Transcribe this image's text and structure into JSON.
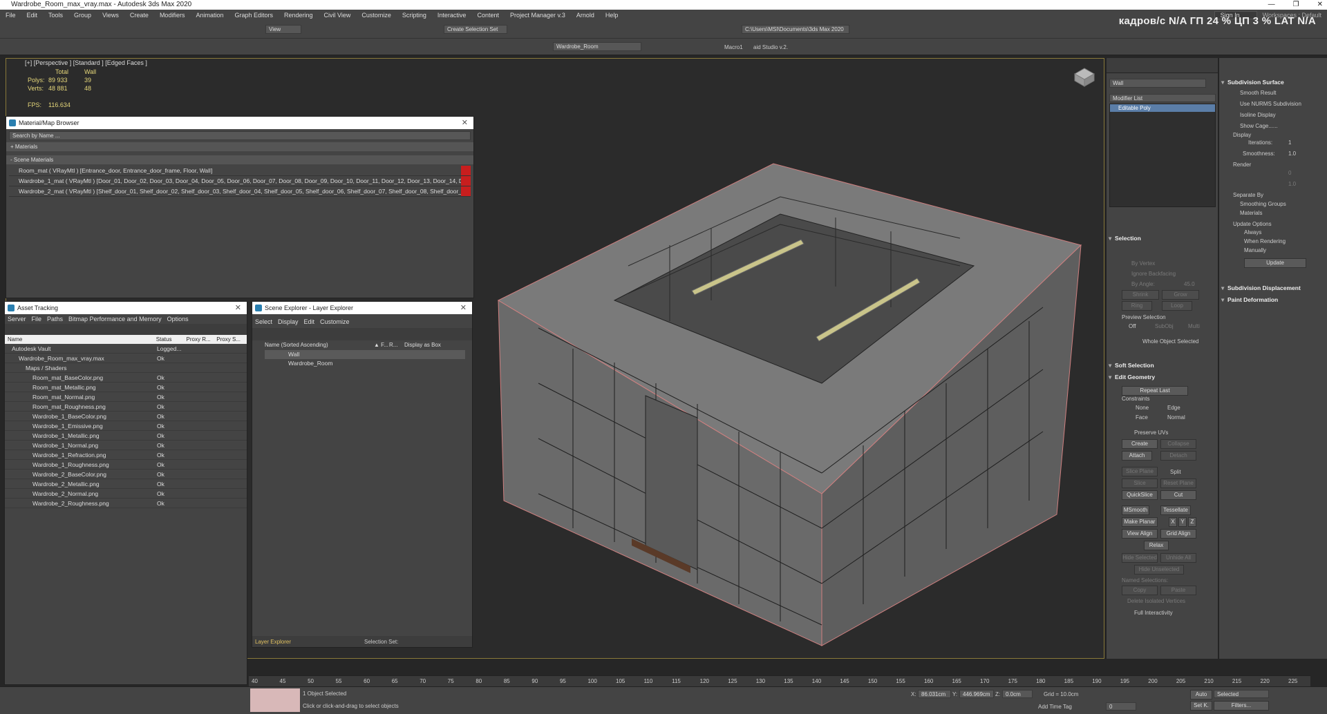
{
  "window": {
    "title": "Wardrobe_Room_max_vray.max - Autodesk 3ds Max 2020"
  },
  "menu": [
    "File",
    "Edit",
    "Tools",
    "Group",
    "Views",
    "Create",
    "Modifiers",
    "Animation",
    "Graph Editors",
    "Rendering",
    "Civil View",
    "Customize",
    "Scripting",
    "Interactive",
    "Content",
    "Project Manager v.3",
    "Arnold",
    "Help"
  ],
  "menu_right": {
    "signin": "Sign In",
    "workspaces": "Workspaces : Default"
  },
  "hud": {
    "text": "кадров/с N/A ГП 24 % ЦП 3 % LAT N/A"
  },
  "toolbar": {
    "view_label": "View",
    "selection_set": "Create Selection Set",
    "path": "C:\\Users\\MSI\\Documents\\3ds Max 2020",
    "layer": "Wardrobe_Room",
    "macro": "Macro1",
    "studio": "aid Studio v.2."
  },
  "viewport": {
    "label": "[+] [Perspective ] [Standard ] [Edged Faces ]",
    "stats": {
      "h_total": "Total",
      "h_wall": "Wall",
      "polys_label": "Polys:",
      "polys_total": "89 933",
      "polys_wall": "39",
      "verts_label": "Verts:",
      "verts_total": "48 881",
      "verts_wall": "48",
      "fps_label": "FPS:",
      "fps": "116.634"
    }
  },
  "material_browser": {
    "title": "Material/Map Browser",
    "search": "Search by Name ...",
    "materials": "+ Materials",
    "scene_materials": "- Scene Materials",
    "rows": [
      "Room_mat ( VRayMtl ) [Entrance_door, Entrance_door_frame, Floor, Wall]",
      "Wardrobe_1_mat ( VRayMtl ) [Door_01, Door_02, Door_03, Door_04, Door_05, Door_06, Door_07, Door_08, Door_09, Door_10, Door_11, Door_12, Door_13, Door_14, Do...",
      "Wardrobe_2_mat ( VRayMtl ) [Shelf_door_01, Shelf_door_02, Shelf_door_03, Shelf_door_04, Shelf_door_05, Shelf_door_06, Shelf_door_07, Shelf_door_08, Shelf_door_09,..."
    ]
  },
  "asset_tracking": {
    "title": "Asset Tracking",
    "menu": [
      "Server",
      "File",
      "Paths",
      "Bitmap Performance and Memory",
      "Options"
    ],
    "cols": [
      "Name",
      "Status",
      "Proxy R...",
      "Proxy S..."
    ],
    "rows": [
      {
        "name": "Autodesk Vault",
        "status": "Logged...",
        "indent": 1
      },
      {
        "name": "Wardrobe_Room_max_vray.max",
        "status": "Ok",
        "indent": 2
      },
      {
        "name": "Maps / Shaders",
        "status": "",
        "indent": 3
      },
      {
        "name": "Room_mat_BaseColor.png",
        "status": "Ok",
        "indent": 4
      },
      {
        "name": "Room_mat_Metallic.png",
        "status": "Ok",
        "indent": 4
      },
      {
        "name": "Room_mat_Normal.png",
        "status": "Ok",
        "indent": 4
      },
      {
        "name": "Room_mat_Roughness.png",
        "status": "Ok",
        "indent": 4
      },
      {
        "name": "Wardrobe_1_BaseColor.png",
        "status": "Ok",
        "indent": 4
      },
      {
        "name": "Wardrobe_1_Emissive.png",
        "status": "Ok",
        "indent": 4
      },
      {
        "name": "Wardrobe_1_Metallic.png",
        "status": "Ok",
        "indent": 4
      },
      {
        "name": "Wardrobe_1_Normal.png",
        "status": "Ok",
        "indent": 4
      },
      {
        "name": "Wardrobe_1_Refraction.png",
        "status": "Ok",
        "indent": 4
      },
      {
        "name": "Wardrobe_1_Roughness.png",
        "status": "Ok",
        "indent": 4
      },
      {
        "name": "Wardrobe_2_BaseColor.png",
        "status": "Ok",
        "indent": 4
      },
      {
        "name": "Wardrobe_2_Metallic.png",
        "status": "Ok",
        "indent": 4
      },
      {
        "name": "Wardrobe_2_Normal.png",
        "status": "Ok",
        "indent": 4
      },
      {
        "name": "Wardrobe_2_Roughness.png",
        "status": "Ok",
        "indent": 4
      }
    ]
  },
  "scene_explorer": {
    "title": "Scene Explorer - Layer Explorer",
    "menu": [
      "Select",
      "Display",
      "Edit",
      "Customize"
    ],
    "col_name": "Name (Sorted Ascending)",
    "col_f": "▲ F...",
    "col_r": "R...",
    "col_box": "Display as Box",
    "items": [
      "Wall",
      "Wardrobe_Room"
    ],
    "footer_label": "Layer Explorer",
    "selection_set": "Selection Set:"
  },
  "command_panel": {
    "object_name": "Wall",
    "modifier_list": "Modifier List",
    "stack_item": "Editable Poly",
    "selection": {
      "title": "Selection",
      "by_vertex": "By Vertex",
      "ignore_backfacing": "Ignore Backfacing",
      "by_angle": "By Angle:",
      "angle": "45.0",
      "shrink": "Shrink",
      "grow": "Grow",
      "ring": "Ring",
      "loop": "Loop",
      "preview": "Preview Selection",
      "off": "Off",
      "subobj": "SubObj",
      "multi": "Multi",
      "whole": "Whole Object Selected"
    },
    "soft_selection": "Soft Selection",
    "edit_geometry": {
      "title": "Edit Geometry",
      "repeat": "Repeat Last",
      "constraints": "Constraints",
      "none": "None",
      "edge": "Edge",
      "face": "Face",
      "normal": "Normal",
      "preserve": "Preserve UVs",
      "create": "Create",
      "collapse": "Collapse",
      "attach": "Attach",
      "detach": "Detach",
      "slice_plane": "Slice Plane",
      "split": "Split",
      "slice": "Slice",
      "reset_plane": "Reset Plane",
      "quickslice": "QuickSlice",
      "cut": "Cut",
      "msmooth": "MSmooth",
      "tessellate": "Tessellate",
      "make_planar": "Make Planar",
      "x": "X",
      "y": "Y",
      "z": "Z",
      "view_align": "View Align",
      "grid_align": "Grid Align",
      "relax": "Relax",
      "hide_sel": "Hide Selected",
      "unhide_all": "Unhide All",
      "hide_unsel": "Hide Unselected",
      "named": "Named Selections:",
      "copy": "Copy",
      "paste": "Paste",
      "delete_iso": "Delete Isolated Vertices",
      "full_inter": "Full Interactivity"
    }
  },
  "subdivision": {
    "title": "Subdivision Surface",
    "smooth": "Smooth Result",
    "nurms": "Use NURMS Subdivision",
    "isoline": "Isoline Display",
    "cage": "Show Cage......",
    "display": "Display",
    "iterations": "Iterations:",
    "iter_val": "1",
    "smoothness": "Smoothness:",
    "smooth_val": "1.0",
    "render": "Render",
    "r_iter_val": "0",
    "r_smooth_val": "1.0",
    "separate": "Separate By",
    "smoothing_groups": "Smoothing Groups",
    "materials": "Materials",
    "update_options": "Update Options",
    "always": "Always",
    "when_rendering": "When Rendering",
    "manually": "Manually",
    "update": "Update",
    "disp": "Subdivision Displacement",
    "paint": "Paint Deformation"
  },
  "timeline": {
    "ticks": [
      "40",
      "45",
      "50",
      "55",
      "60",
      "65",
      "70",
      "75",
      "80",
      "85",
      "90",
      "95",
      "100",
      "105",
      "110",
      "115",
      "120",
      "125",
      "130",
      "135",
      "140",
      "145",
      "150",
      "155",
      "160",
      "165",
      "170",
      "175",
      "180",
      "185",
      "190",
      "195",
      "200",
      "205",
      "210",
      "215",
      "220",
      "225"
    ]
  },
  "status": {
    "selected": "1 Object Selected",
    "prompt": "Click or click-and-drag to select objects",
    "x_label": "X:",
    "x": "86.031cm",
    "y_label": "Y:",
    "y": "446.969cm",
    "z_label": "Z:",
    "z": "0.0cm",
    "grid": "Grid = 10.0cm",
    "add_time_tag": "Add Time Tag",
    "auto": "Auto",
    "setk": "Set K.",
    "selected_dd": "Selected",
    "filters": "Filters...",
    "frame": "0"
  },
  "colors": {
    "accent": "#2a7fb0",
    "viewport_border": "#8a7a3a",
    "selection": "#5b7ea8"
  }
}
